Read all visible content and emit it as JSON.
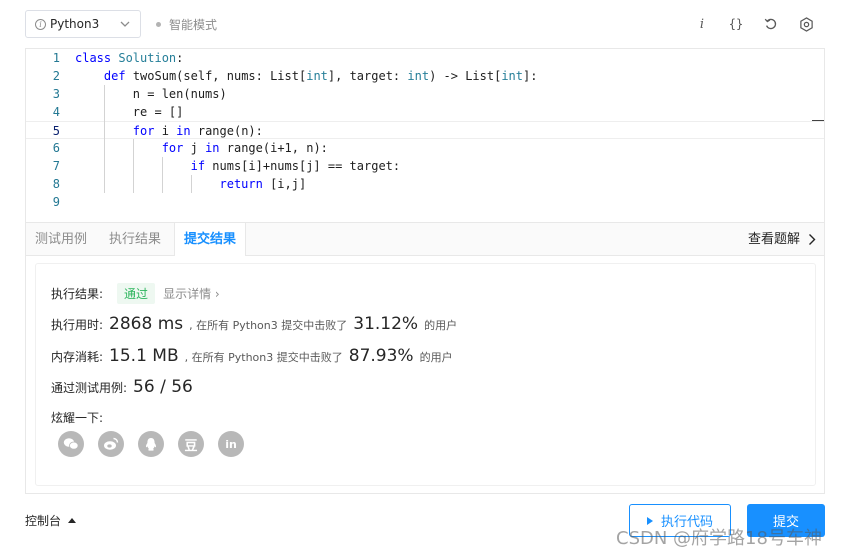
{
  "toolbar": {
    "language": "Python3",
    "smart_mode": "智能模式",
    "icons": [
      "info-icon",
      "format-braces-icon",
      "reset-icon",
      "settings-icon"
    ],
    "info_glyph": "i",
    "braces_glyph": "{}"
  },
  "editor": {
    "lines": [
      {
        "n": "1",
        "indent": 0
      },
      {
        "n": "2",
        "indent": 1
      },
      {
        "n": "3",
        "indent": 2
      },
      {
        "n": "4",
        "indent": 2
      },
      {
        "n": "5",
        "indent": 2
      },
      {
        "n": "6",
        "indent": 3
      },
      {
        "n": "7",
        "indent": 4
      },
      {
        "n": "8",
        "indent": 5
      },
      {
        "n": "9",
        "indent": 0
      }
    ],
    "code": [
      "class Solution:",
      "    def twoSum(self, nums: List[int], target: int) -> List[int]:",
      "        n = len(nums)",
      "        re = []",
      "        for i in range(n):",
      "            for j in range(i+1, n):",
      "                if nums[i]+nums[j] == target:",
      "                    return [i,j]",
      ""
    ],
    "active_line": "5"
  },
  "tabs": {
    "items": [
      "测试用例",
      "执行结果",
      "提交结果"
    ],
    "active": "提交结果",
    "view_solution": "查看题解"
  },
  "result": {
    "status_label": "执行结果:",
    "status_badge": "通过",
    "show_detail": "显示详情",
    "time_label": "执行用时:",
    "time_value": "2868 ms",
    "time_mid": ", 在所有 Python3 提交中击败了",
    "time_pct": "31.12%",
    "time_tail": "的用户",
    "mem_label": "内存消耗:",
    "mem_value": "15.1 MB",
    "mem_mid": ", 在所有 Python3 提交中击败了",
    "mem_pct": "87.93%",
    "mem_tail": "的用户",
    "cases_label": "通过测试用例:",
    "cases_value": "56 / 56",
    "share_label": "炫耀一下:",
    "share_icons": [
      "wechat-icon",
      "weibo-icon",
      "qq-icon",
      "douban-icon",
      "linkedin-icon"
    ],
    "douban_glyph": "豆",
    "linkedin_glyph": "in"
  },
  "footer": {
    "console": "控制台",
    "run": "执行代码",
    "submit": "提交",
    "watermark": "CSDN @府学路18号车神"
  },
  "colors": {
    "accent": "#1890ff",
    "pass_green": "#2db55d"
  }
}
